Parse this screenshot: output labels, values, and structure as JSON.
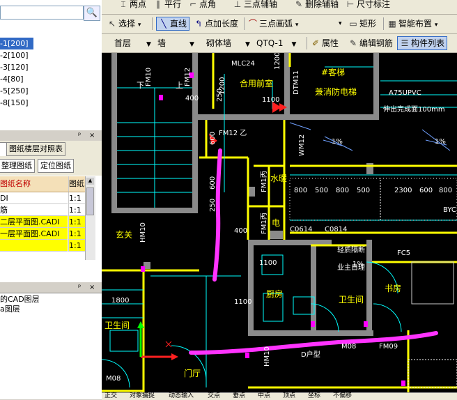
{
  "left_panel": {
    "search_icon": "search-icon",
    "layers": [
      {
        "label": "-1[200]",
        "selected": true
      },
      {
        "label": "-2[100]",
        "selected": false
      },
      {
        "label": "-3[120]",
        "selected": false
      },
      {
        "label": "-4[80]",
        "selected": false
      },
      {
        "label": "-5[250]",
        "selected": false
      },
      {
        "label": "-8[150]",
        "selected": false
      }
    ],
    "pin_glyph": "ᵖ",
    "close_glyph": "×",
    "tabs": {
      "floor_table": "图纸楼层对照表"
    },
    "buttons": {
      "organize": "整理图纸",
      "locate": "定位图纸"
    },
    "grid": {
      "headers": [
        "图纸名称",
        "图纸"
      ],
      "rows": [
        {
          "name": "DI",
          "scale": "1:1",
          "highlight": false
        },
        {
          "name": "筋",
          "scale": "1:1",
          "highlight": false
        },
        {
          "name": "二层平面图.CADI",
          "scale": "1:1",
          "highlight": true
        },
        {
          "name": "一层平面图.CADI",
          "scale": "1:1",
          "highlight": true
        },
        {
          "name": "",
          "scale": "1:1",
          "highlight": true
        }
      ]
    },
    "bottom_list": [
      "的CAD图层",
      "a图层"
    ]
  },
  "toolbar1": {
    "items": [
      "两点",
      "平行",
      "点角",
      "三点辅轴",
      "删除辅轴",
      "尺寸标注"
    ]
  },
  "toolbar2": {
    "select": "选择",
    "line": "直线",
    "point_length": "点加长度",
    "arc3": "三点画弧",
    "rect": "矩形",
    "smart_layout": "智能布置"
  },
  "toolbar3": {
    "floor": "首层",
    "category": "墙",
    "type": "砌体墙",
    "element": "QTQ-1",
    "properties": "属性",
    "edit_rebar": "编辑钢筋",
    "component_list": "构件列表"
  },
  "cad": {
    "rooms": [
      "合用前室",
      "#客梯",
      "兼消防电梯",
      "水暖",
      "电",
      "厨房",
      "卫生间",
      "书房",
      "玄关",
      "卫生间",
      "门厅",
      "业主自理",
      "轻质隔断"
    ],
    "labels": [
      "FM10",
      "FM12",
      "MLC24",
      "DTM11",
      "A75UPVC",
      "伸出完成面100mm",
      "FM12 乙",
      "WM12",
      "FM1丙",
      "FM1丙",
      "HM10",
      "M08",
      "FM09",
      "HM10",
      "M08",
      "C0614",
      "C0814",
      "FC5",
      "BYC",
      "D户型",
      "1%",
      "1%",
      "1%",
      "下",
      "上",
      "1100",
      "1800",
      "1100",
      "1100",
      "400",
      "400",
      "600",
      "250",
      "600",
      "250",
      "800",
      "500",
      "800",
      "500",
      "2300",
      "600",
      "800",
      "1200",
      "1200"
    ],
    "colors": {
      "wall": "#ffff00",
      "line": "#00ffff",
      "pink": "#ff33ff",
      "red": "#ff2020",
      "green": "#00ff00"
    }
  },
  "status": {
    "items": [
      "正交",
      "对象捕捉",
      "动态输入",
      "交点",
      "垂点",
      "中点",
      "顶点",
      "坐标",
      "不偏移"
    ]
  }
}
